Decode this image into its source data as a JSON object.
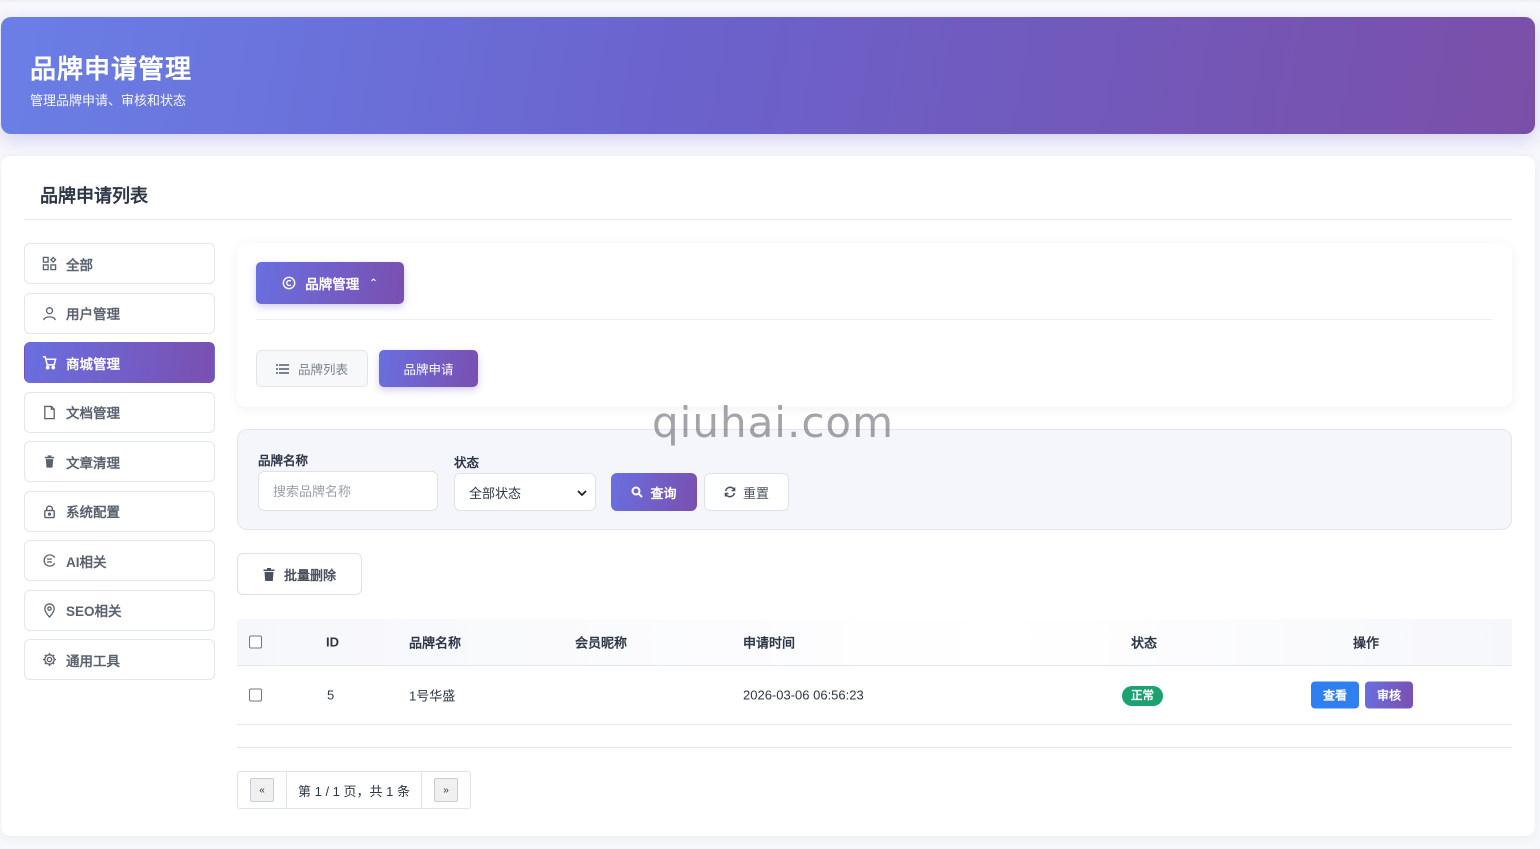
{
  "header": {
    "title": "品牌申请管理",
    "subtitle": "管理品牌申请、审核和状态"
  },
  "card": {
    "title": "品牌申请列表"
  },
  "sidebar": {
    "items": [
      {
        "label": "全部",
        "icon": "grid-icon",
        "active": false
      },
      {
        "label": "用户管理",
        "icon": "user-icon",
        "active": false
      },
      {
        "label": "商城管理",
        "icon": "cart-icon",
        "active": true
      },
      {
        "label": "文档管理",
        "icon": "document-icon",
        "active": false
      },
      {
        "label": "文章清理",
        "icon": "trash-icon",
        "active": false
      },
      {
        "label": "系统配置",
        "icon": "lock-icon",
        "active": false
      },
      {
        "label": "AI相关",
        "icon": "ai-icon",
        "active": false
      },
      {
        "label": "SEO相关",
        "icon": "location-pin-icon",
        "active": false
      },
      {
        "label": "通用工具",
        "icon": "gear-icon",
        "active": false
      }
    ]
  },
  "nav": {
    "main_label": "品牌管理",
    "main_icon": "copyright-icon",
    "caret": "⌃",
    "tabs": [
      {
        "label": "品牌列表",
        "icon": "list-icon",
        "active": false
      },
      {
        "label": "品牌申请",
        "icon": "",
        "active": true
      }
    ]
  },
  "watermark": "qiuhai.com",
  "filter": {
    "name_label": "品牌名称",
    "name_placeholder": "搜索品牌名称",
    "status_label": "状态",
    "status_value": "全部状态",
    "query_label": "查询",
    "reset_label": "重置"
  },
  "batch_delete_label": "批量删除",
  "table": {
    "columns": [
      "ID",
      "品牌名称",
      "会员昵称",
      "申请时间",
      "状态",
      "操作"
    ],
    "rows": [
      {
        "id": "5",
        "brand_name": "1号华盛",
        "member_nickname": "",
        "apply_time": "2026-03-06 06:56:23",
        "status": "正常",
        "actions": [
          "查看",
          "审核"
        ]
      }
    ]
  },
  "pagination": {
    "prev": "«",
    "info": "第 1 / 1 页，共 1 条",
    "next": "»"
  },
  "colors": {
    "accent_start": "#6a6fe0",
    "accent_end": "#7a4fb0",
    "status_green": "#1aa36f",
    "view_blue": "#2f7ff0"
  }
}
